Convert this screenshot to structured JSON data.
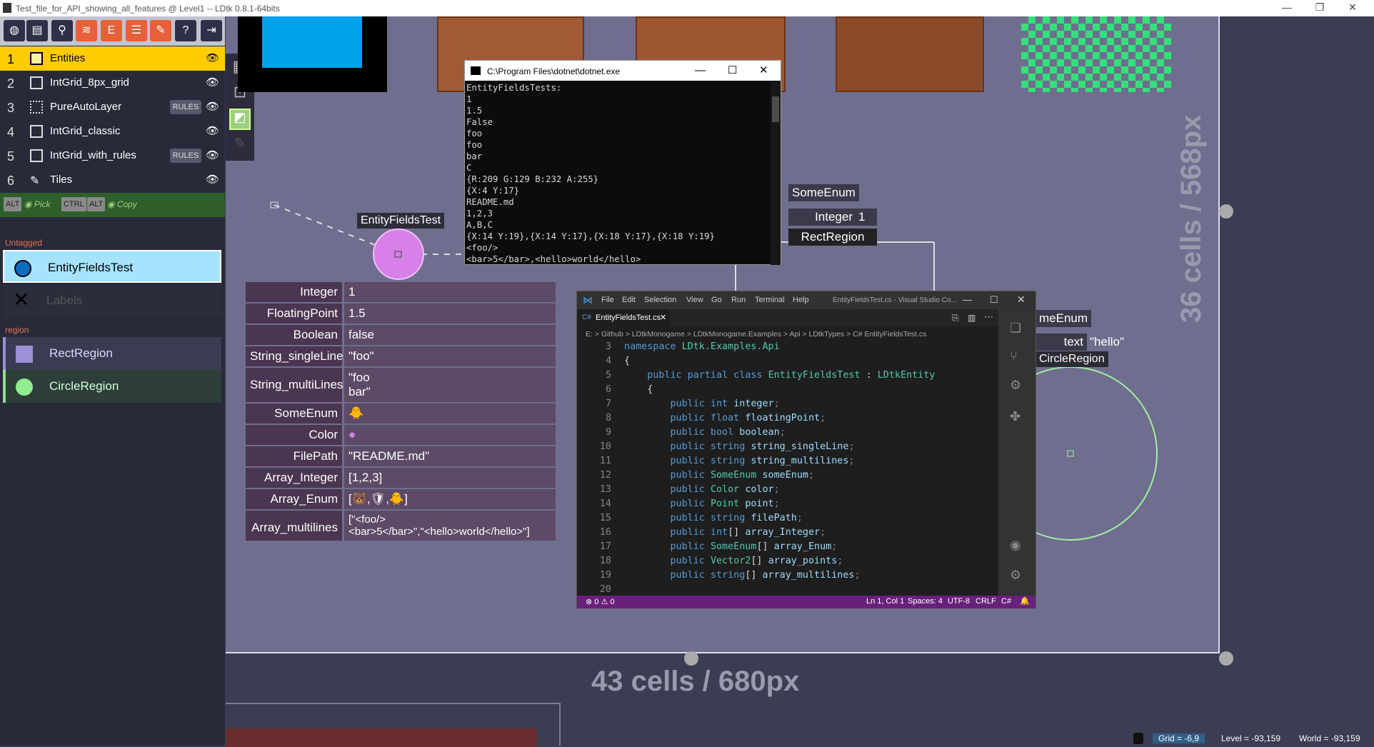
{
  "window": {
    "title": "Test_file_for_API_showing_all_features @ Level1   --   LDtk 0.8.1-64bits",
    "controls": [
      "—",
      "❐",
      "✕"
    ]
  },
  "toolbar": {
    "icons": [
      "world-icon",
      "project-icon",
      "level-icon",
      "layers-icon",
      "entities-icon",
      "enums-icon",
      "tilesets-icon",
      "help-icon",
      "exit-icon"
    ]
  },
  "layers": [
    {
      "num": "1",
      "name": "Entities",
      "rules": ""
    },
    {
      "num": "2",
      "name": "IntGrid_8px_grid",
      "rules": ""
    },
    {
      "num": "3",
      "name": "PureAutoLayer",
      "rules": "RULES"
    },
    {
      "num": "4",
      "name": "IntGrid_classic",
      "rules": ""
    },
    {
      "num": "5",
      "name": "IntGrid_with_rules",
      "rules": "RULES"
    },
    {
      "num": "6",
      "name": "Tiles",
      "rules": ""
    }
  ],
  "hotkeys": {
    "alt": "ALT",
    "pick": "Pick",
    "ctrl": "CTRL",
    "alt2": "ALT",
    "copy": "Copy"
  },
  "palette": {
    "untagged_label": "Untagged",
    "region_label": "region",
    "entities": [
      {
        "name": "EntityFieldsTest"
      },
      {
        "name": "Labels"
      },
      {
        "name": "RectRegion"
      },
      {
        "name": "CircleRegion"
      }
    ]
  },
  "canvas": {
    "entity_label": "EntityFieldsTest",
    "fields": [
      {
        "k": "Integer",
        "v": "1"
      },
      {
        "k": "FloatingPoint",
        "v": "1.5"
      },
      {
        "k": "Boolean",
        "v": "false"
      },
      {
        "k": "String_singleLine",
        "v": "\"foo\""
      },
      {
        "k": "String_multiLines",
        "v": "\"foo\nbar\""
      },
      {
        "k": "SomeEnum",
        "v": "🐥"
      },
      {
        "k": "Color",
        "v": "●"
      },
      {
        "k": "FilePath",
        "v": "\"README.md\""
      },
      {
        "k": "Array_Integer",
        "v": "[1,2,3]"
      },
      {
        "k": "Array_Enum",
        "v": "[🐻,🛡,🐥]"
      },
      {
        "k": "Array_multilines",
        "v": "[\"<foo/>\n<bar>5</bar>\",\"<hello>world</hello>\"]"
      }
    ],
    "someenum_label": "SomeEnum",
    "integer_label": "Integer",
    "integer_value": "1",
    "rectregion_label": "RectRegion",
    "someenum2_label": "meEnum",
    "text_label": "text",
    "text_value": "\"hello\"",
    "circleregion_label": "CircleRegion",
    "height_label": "36 cells / 568px",
    "width_label": "43 cells / 680px"
  },
  "console": {
    "title": "C:\\Program Files\\dotnet\\dotnet.exe",
    "lines": "EntityFieldsTests:\n1\n1.5\nFalse\nfoo\nfoo\nbar\nC\n{R:209 G:129 B:232 A:255}\n{X:4 Y:17}\nREADME.md\n1,2,3\nA,B,C\n{X:14 Y:19},{X:14 Y:17},{X:18 Y:17},{X:18 Y:19}\n<foo/>\n<bar>5</bar>,<hello>world</hello>"
  },
  "vscode": {
    "menu": [
      "File",
      "Edit",
      "Selection",
      "View",
      "Go",
      "Run",
      "Terminal",
      "Help"
    ],
    "title": "EntityFieldsTest.cs - Visual Studio Co...",
    "tab": "EntityFieldsTest.cs",
    "breadcrumb": "E: > Github > LDtkMonogame > LDtkMonogame.Examples > Api > LDtkTypes > C# EntityFieldsTest.cs",
    "lines": [
      {
        "n": "3",
        "html": "<span class='kw'>namespace</span> <span class='ty'>LDtk.Examples.Api</span>"
      },
      {
        "n": "4",
        "html": "{"
      },
      {
        "n": "5",
        "html": "    <span class='kw'>public partial class</span> <span class='ty'>EntityFieldsTest</span> : <span class='ty'>LDtkEntity</span>"
      },
      {
        "n": "6",
        "html": "    {"
      },
      {
        "n": "7",
        "html": "        <span class='kw'>public int</span> <span class='id'>integer</span><span class='pu'>;</span>"
      },
      {
        "n": "8",
        "html": "        <span class='kw'>public float</span> <span class='id'>floatingPoint</span><span class='pu'>;</span>"
      },
      {
        "n": "9",
        "html": "        <span class='kw'>public bool</span> <span class='id'>boolean</span><span class='pu'>;</span>"
      },
      {
        "n": "10",
        "html": "        <span class='kw'>public string</span> <span class='id'>string_singleLine</span><span class='pu'>;</span>"
      },
      {
        "n": "11",
        "html": "        <span class='kw'>public string</span> <span class='id'>string_multilines</span><span class='pu'>;</span>"
      },
      {
        "n": "12",
        "html": "        <span class='kw'>public</span> <span class='ty'>SomeEnum</span> <span class='id'>someEnum</span><span class='pu'>;</span>"
      },
      {
        "n": "13",
        "html": "        <span class='kw'>public</span> <span class='ty'>Color</span> <span class='id'>color</span><span class='pu'>;</span>"
      },
      {
        "n": "14",
        "html": "        <span class='kw'>public</span> <span class='ty'>Point</span> <span class='id'>point</span><span class='pu'>;</span>"
      },
      {
        "n": "15",
        "html": "        <span class='kw'>public string</span> <span class='id'>filePath</span><span class='pu'>;</span>"
      },
      {
        "n": "16",
        "html": "        <span class='kw'>public int</span>[] <span class='id'>array_Integer</span><span class='pu'>;</span>"
      },
      {
        "n": "17",
        "html": "        <span class='kw'>public</span> <span class='ty'>SomeEnum</span>[] <span class='id'>array_Enum</span><span class='pu'>;</span>"
      },
      {
        "n": "18",
        "html": "        <span class='kw'>public</span> <span class='ty'>Vector2</span>[] <span class='id'>array_points</span><span class='pu'>;</span>"
      },
      {
        "n": "19",
        "html": "        <span class='kw'>public string</span>[] <span class='id'>array_multilines</span><span class='pu'>;</span>"
      },
      {
        "n": "20",
        "html": ""
      }
    ],
    "status_left": "⊗ 0 ⚠ 0",
    "status_right": [
      "Ln 1, Col 1",
      "Spaces: 4",
      "UTF-8",
      "CRLF",
      "C#"
    ]
  },
  "statusbar": {
    "grid": "Grid = -6,9",
    "level": "Level = -93,159",
    "world": "World = -93,159"
  }
}
